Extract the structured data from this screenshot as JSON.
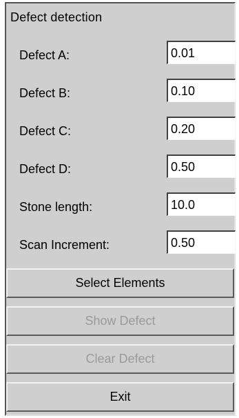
{
  "panel": {
    "title": "Defect detection"
  },
  "fields": [
    {
      "label": "Defect A:",
      "value": "0.01"
    },
    {
      "label": "Defect B:",
      "value": "0.10"
    },
    {
      "label": "Defect C:",
      "value": "0.20"
    },
    {
      "label": "Defect D:",
      "value": "0.50"
    },
    {
      "label": "Stone length:",
      "value": "10.0"
    },
    {
      "label": "Scan Increment:",
      "value": "0.50"
    }
  ],
  "buttons": {
    "select_elements": "Select Elements",
    "show_defect": "Show Defect",
    "clear_defect": "Clear Defect",
    "exit": "Exit"
  },
  "colors": {
    "panel_background": "#cfcfcf",
    "disabled_text": "#9a9a9a"
  }
}
